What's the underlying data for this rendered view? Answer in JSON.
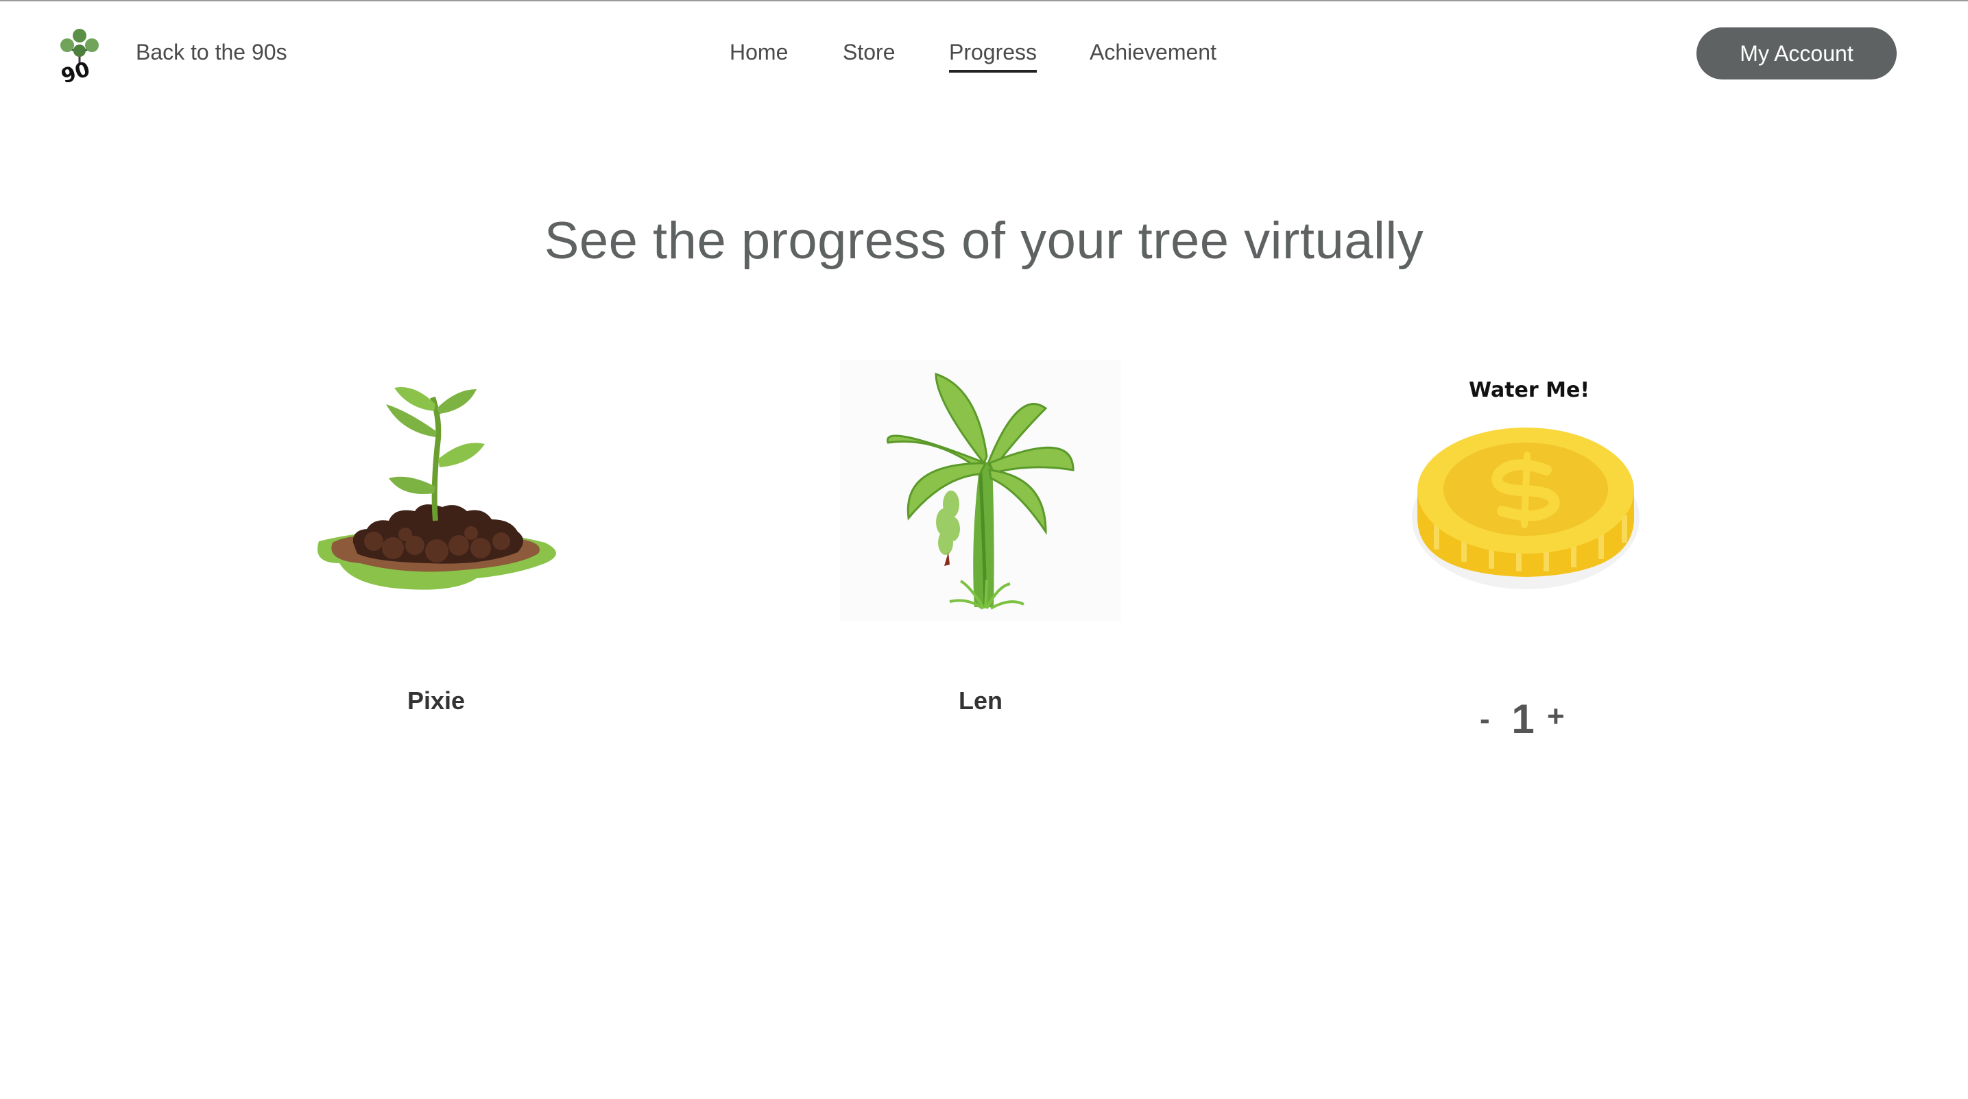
{
  "header": {
    "brand": "Back to the 90s",
    "logo_text": "90",
    "nav": [
      {
        "label": "Home",
        "active": false
      },
      {
        "label": "Store",
        "active": false
      },
      {
        "label": "Progress",
        "active": true
      },
      {
        "label": "Achievement",
        "active": false
      }
    ],
    "account_button": "My Account"
  },
  "main": {
    "title": "See the progress of your tree virtually",
    "trees": [
      {
        "name": "Pixie",
        "icon": "sprout-icon"
      },
      {
        "name": "Len",
        "icon": "banana-tree-icon"
      }
    ],
    "water": {
      "label": "Water Me!",
      "icon": "gold-coin-icon",
      "minus": "-",
      "value": "1",
      "plus": "+"
    }
  },
  "colors": {
    "button_bg": "#5f6262",
    "title": "#5f6262",
    "leaf_green": "#7cb342",
    "coin_gold": "#f5c518"
  }
}
